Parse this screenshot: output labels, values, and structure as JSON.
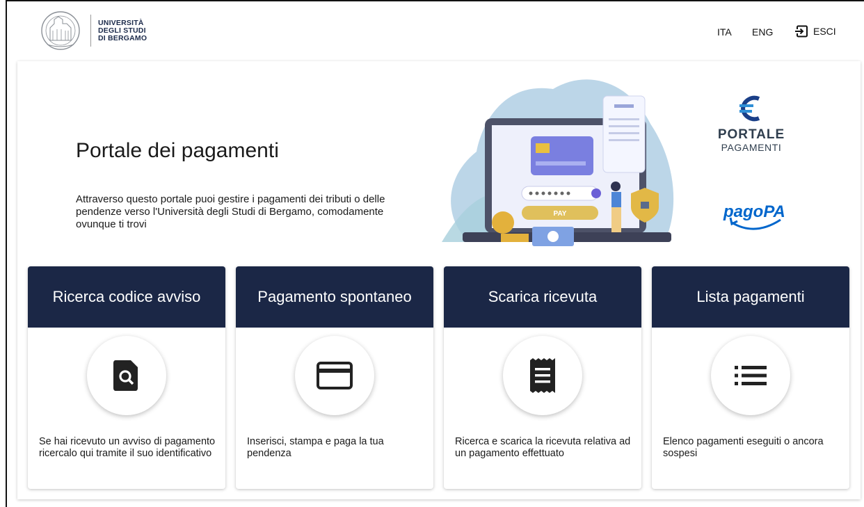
{
  "header": {
    "logo_lines": [
      "UNIVERSITÀ",
      "DEGLI STUDI",
      "DI BERGAMO"
    ],
    "lang_ita": "ITA",
    "lang_eng": "ENG",
    "logout_label": "ESCI"
  },
  "hero": {
    "title": "Portale dei pagamenti",
    "description": "Attraverso questo portale puoi gestire i pagamenti dei tributi o delle pendenze verso l'Università degli Studi di Bergamo, comodamente ovunque ti trovi",
    "illustration_pay_label": "PAY",
    "portale_logo_word1": "PORTALE",
    "portale_logo_word2": "PAGAMENTI",
    "pagopa_logo_text": "pagoPA"
  },
  "cards": [
    {
      "title": "Ricerca codice avviso",
      "icon": "document-search-icon",
      "text": "Se hai ricevuto un avviso di pagamento ricercalo qui tramite il suo identificativo"
    },
    {
      "title": "Pagamento spontaneo",
      "icon": "credit-card-icon",
      "text": "Inserisci, stampa e paga la tua pendenza"
    },
    {
      "title": "Scarica ricevuta",
      "icon": "receipt-icon",
      "text": "Ricerca e scarica la ricevuta relativa ad un pagamento effettuato"
    },
    {
      "title": "Lista pagamenti",
      "icon": "list-icon",
      "text": "Elenco pagamenti eseguiti o ancora sospesi"
    }
  ],
  "colors": {
    "card_header_bg": "#1b2746",
    "brand_text": "#1b2a4a"
  }
}
